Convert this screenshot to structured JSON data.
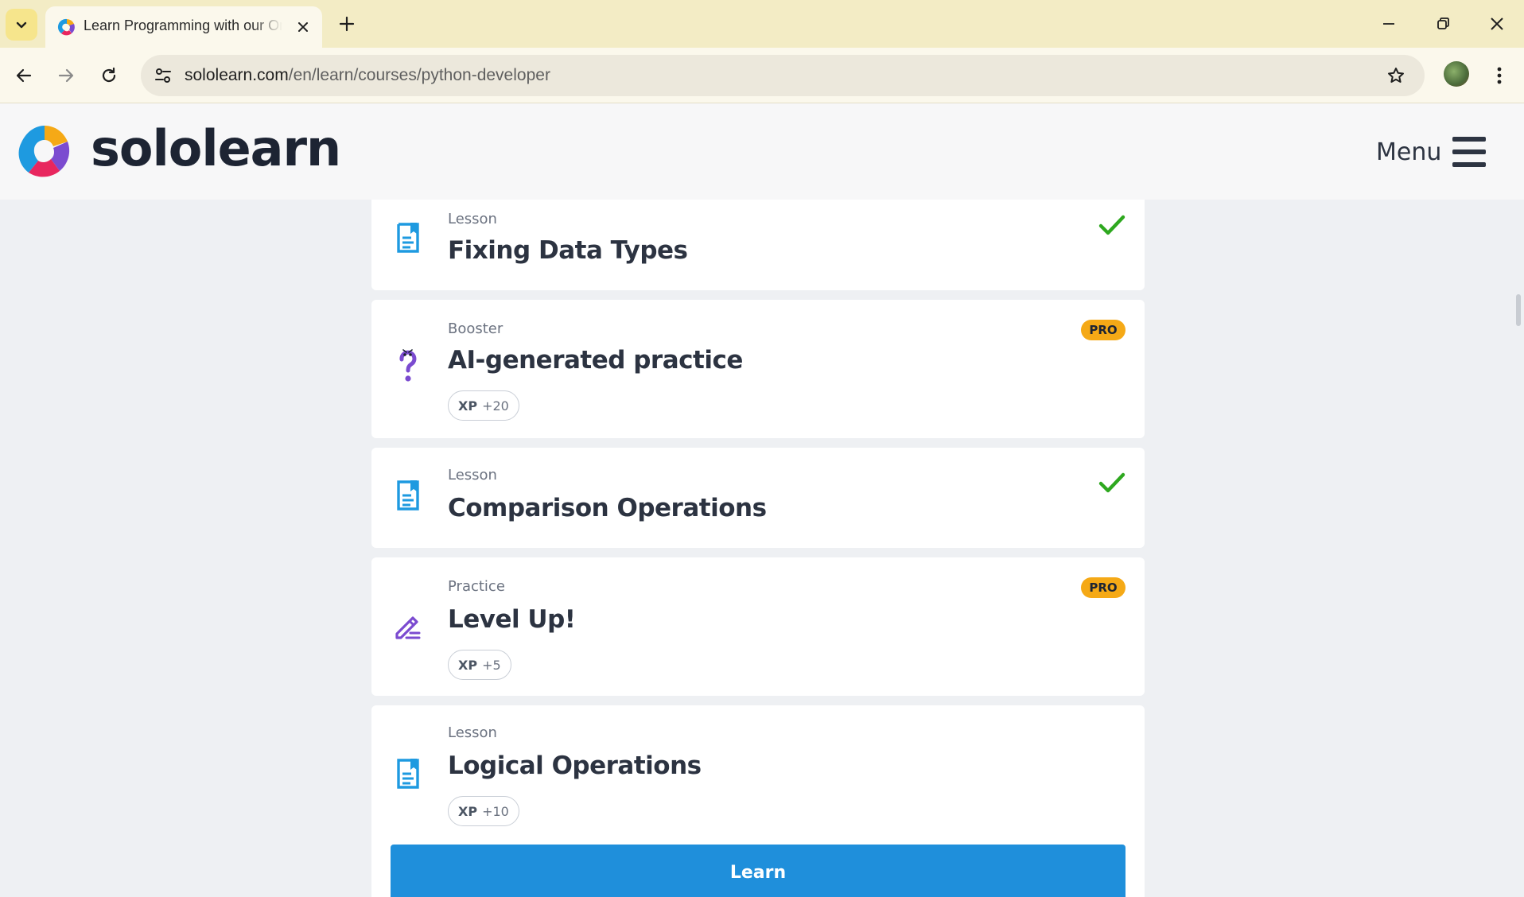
{
  "browser": {
    "tab_title": "Learn Programming with our Online Courses",
    "url_host": "sololearn.com",
    "url_path": "/en/learn/courses/python-developer",
    "new_tab_symbol": "+",
    "icons": [
      "tab-list-icon",
      "favicon-icon",
      "close-icon",
      "plus-icon",
      "minimize-icon",
      "restore-icon",
      "close-window-icon",
      "back-icon",
      "forward-icon",
      "reload-icon",
      "site-info-icon",
      "star-icon",
      "profile-avatar",
      "kebab-menu-icon"
    ]
  },
  "site": {
    "logo_text": "sololearn",
    "menu_label": "Menu"
  },
  "cards": [
    {
      "type": "Lesson",
      "title": "Fixing Data Types",
      "status": "completed",
      "icon": "lesson-icon"
    },
    {
      "type": "Booster",
      "title": "AI-generated practice",
      "badge": "PRO",
      "xp_label": "XP",
      "xp_value": "+20",
      "icon": "question-mark-icon"
    },
    {
      "type": "Lesson",
      "title": "Comparison Operations",
      "status": "completed",
      "icon": "lesson-icon"
    },
    {
      "type": "Practice",
      "title": "Level Up!",
      "badge": "PRO",
      "xp_label": "XP",
      "xp_value": "+5",
      "icon": "pencil-icon"
    },
    {
      "type": "Lesson",
      "title": "Logical Operations",
      "xp_label": "XP",
      "xp_value": "+10",
      "icon": "lesson-icon"
    }
  ],
  "learn_button": "Learn",
  "colors": {
    "tabbar_bg": "#f3ecc5",
    "brand_blue": "#1f8fdb",
    "pro_badge": "#f5a916",
    "check_green": "#2ea81f",
    "lesson_icon": "#1e9ae0",
    "practice_icon": "#7b4bd0"
  }
}
